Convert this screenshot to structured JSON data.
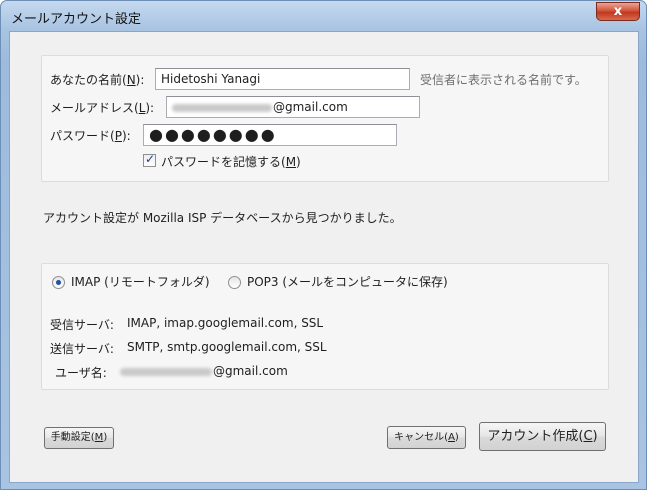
{
  "window": {
    "title": "メールアカウント設定",
    "close_glyph": "x"
  },
  "account": {
    "name_label": "あなたの名前(",
    "name_key": "N",
    "name_tail": "):",
    "name_value": "Hidetoshi Yanagi",
    "name_hint": "受信者に表示される名前です。",
    "email_label": "メールアドレス(",
    "email_key": "L",
    "email_tail": "):",
    "email_domain": "@gmail.com",
    "password_label": "パスワード(",
    "password_key": "P",
    "password_tail": "):",
    "password_value": "●●●●●●●●",
    "remember_label": "パスワードを記憶する(",
    "remember_key": "M",
    "remember_tail": ")",
    "remember_checked": true
  },
  "status_message": "アカウント設定が Mozilla ISP データベースから見つかりました。",
  "server": {
    "imap_label": "IMAP (リモートフォルダ)",
    "pop3_label": "POP3 (メールをコンピュータに保存)",
    "selected": "IMAP",
    "incoming_label": "受信サーバ:",
    "incoming_value": "IMAP, imap.googlemail.com, SSL",
    "outgoing_label": "送信サーバ:",
    "outgoing_value": "SMTP, smtp.googlemail.com, SSL",
    "username_label": "ユーザ名:",
    "username_domain": "@gmail.com"
  },
  "buttons": {
    "manual_label": "手動設定(",
    "manual_key": "M",
    "manual_tail": ")",
    "cancel_label": "キャンセル(",
    "cancel_key": "A",
    "cancel_tail": ")",
    "create_label": "アカウント作成(",
    "create_key": "C",
    "create_tail": ")"
  }
}
